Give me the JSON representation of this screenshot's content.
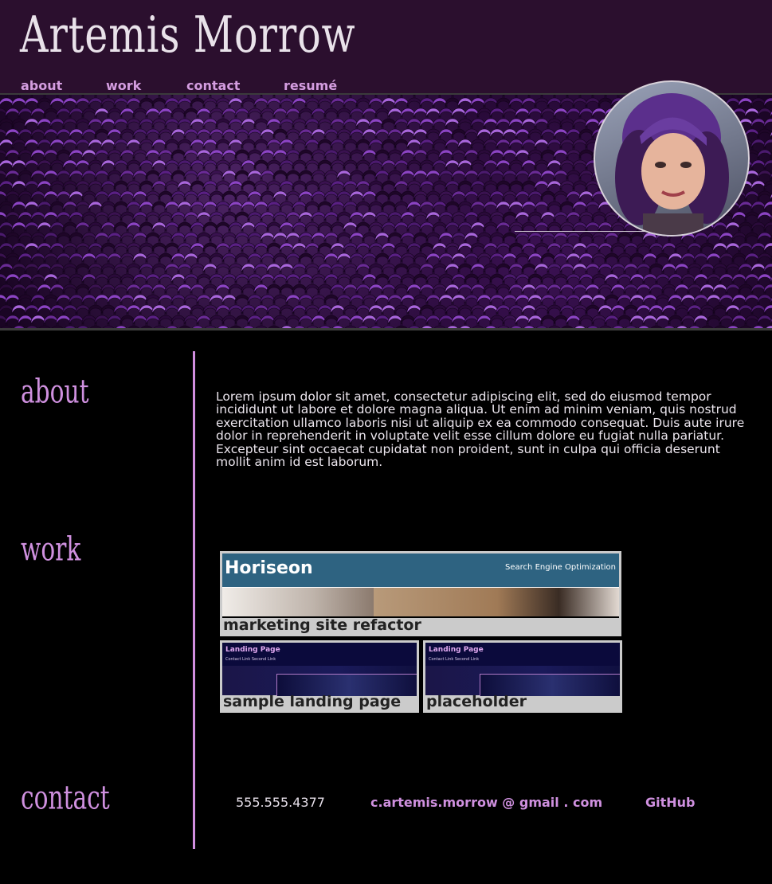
{
  "header": {
    "title": "Artemis Morrow",
    "nav": [
      {
        "label": "about"
      },
      {
        "label": "work"
      },
      {
        "label": "contact"
      },
      {
        "label": "resumé"
      }
    ]
  },
  "about": {
    "heading": "about",
    "text": "Lorem ipsum dolor sit amet, consectetur adipiscing elit, sed do eiusmod tempor incididunt ut labore et dolore magna aliqua. Ut enim ad minim veniam, quis nostrud exercitation ullamco laboris nisi ut aliquip ex ea commodo consequat. Duis aute irure dolor in reprehenderit in voluptate velit esse cillum dolore eu fugiat nulla pariatur. Excepteur sint occaecat cupidatat non proident, sunt in culpa qui officia deserunt mollit anim id est laborum."
  },
  "work": {
    "heading": "work",
    "projects": [
      {
        "caption": "marketing site refactor",
        "thumb_logo": "Horiseon",
        "thumb_tagline": "Search Engine Optimization"
      },
      {
        "caption": "sample landing page",
        "thumb_title": "Landing Page",
        "thumb_links": "Contact    Link    Second Link"
      },
      {
        "caption": "placeholder",
        "thumb_title": "Landing Page",
        "thumb_links": "Contact    Link    Second Link"
      }
    ]
  },
  "contact": {
    "heading": "contact",
    "phone": "555.555.4377",
    "email": "c.artemis.morrow @ gmail . com",
    "github": "GitHub"
  },
  "colors": {
    "header_bg": "#2b0f2e",
    "accent": "#cf90df",
    "page_bg": "#000000"
  }
}
